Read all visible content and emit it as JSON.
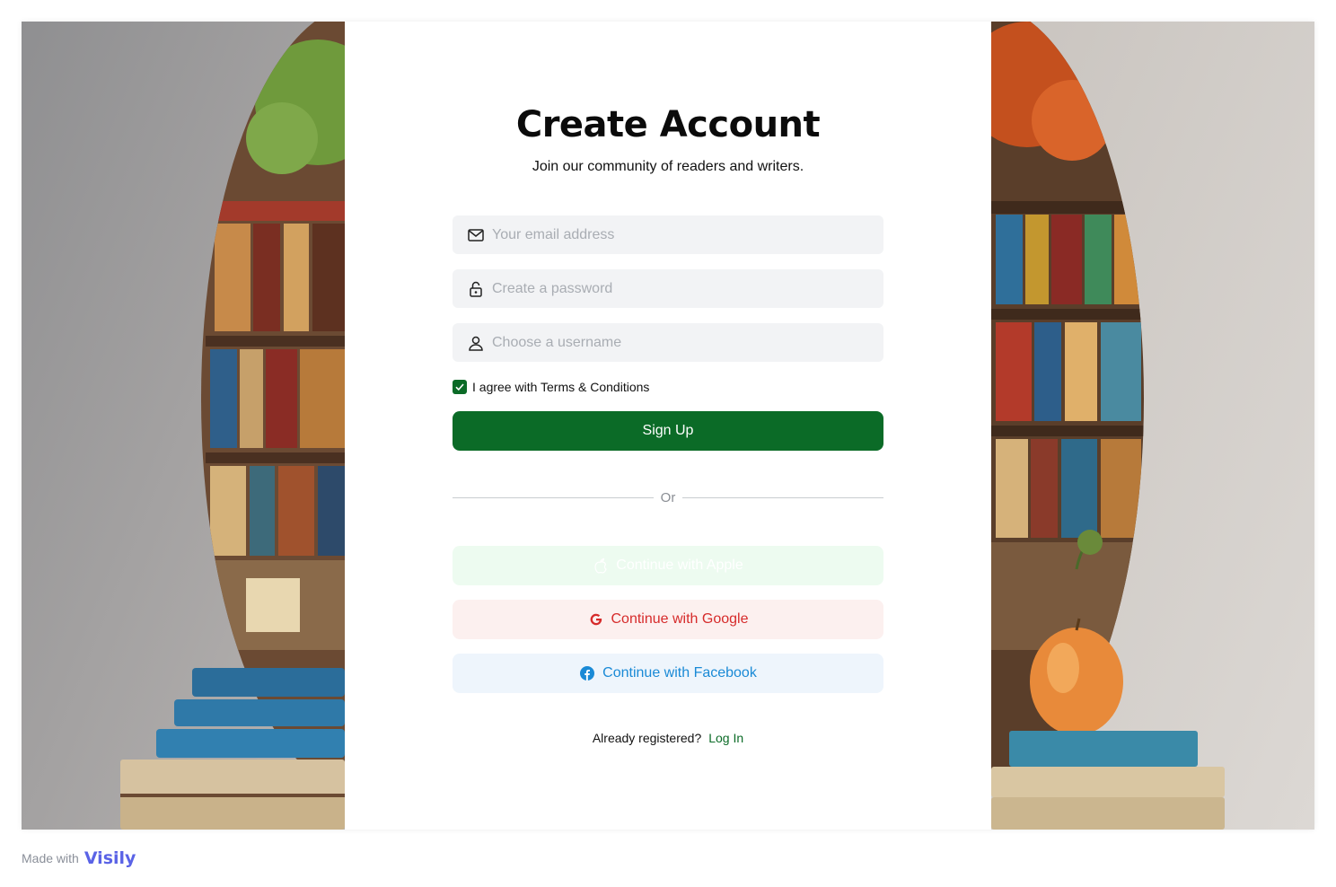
{
  "header": {
    "title": "Create Account",
    "subtitle": "Join our community of readers and writers."
  },
  "form": {
    "email": {
      "placeholder": "Your email address",
      "value": "",
      "icon": "mail-icon"
    },
    "password": {
      "placeholder": "Create a password",
      "value": "",
      "icon": "lock-icon"
    },
    "username": {
      "placeholder": "Choose a username",
      "value": "",
      "icon": "user-icon"
    },
    "terms": {
      "label": "I agree with Terms & Conditions",
      "checked": true
    },
    "submit_label": "Sign Up"
  },
  "divider": {
    "label": "Or"
  },
  "social": {
    "apple": {
      "label": "Continue with Apple",
      "icon": "apple-icon"
    },
    "google": {
      "label": "Continue with Google",
      "icon": "google-icon"
    },
    "facebook": {
      "label": "Continue with Facebook",
      "icon": "facebook-icon"
    }
  },
  "login": {
    "prompt": "Already registered?",
    "link": "Log In"
  },
  "footer": {
    "made_with": "Made with",
    "brand": "Visily"
  },
  "colors": {
    "primary": "#0b6b27",
    "google": "#d62b2b",
    "facebook": "#1a8ad6",
    "brand": "#5a63e6"
  }
}
